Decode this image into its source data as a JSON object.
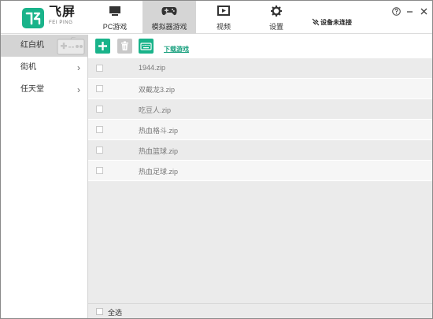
{
  "app": {
    "name_cn": "飞屏",
    "name_en": "FEI PING",
    "accent_color": "#19b38a"
  },
  "tabs": [
    {
      "label": "PC游戏",
      "icon": "monitor-icon",
      "active": false
    },
    {
      "label": "模拟器游戏",
      "icon": "gamepad-icon",
      "active": true
    },
    {
      "label": "视频",
      "icon": "video-icon",
      "active": false
    },
    {
      "label": "设置",
      "icon": "gear-icon",
      "active": false
    }
  ],
  "device_status": "设备未连接",
  "window_controls": [
    "help-icon",
    "minimize-icon",
    "close-icon"
  ],
  "sidebar": {
    "items": [
      {
        "label": "红白机",
        "active": true,
        "has_chevron": false
      },
      {
        "label": "街机",
        "active": false,
        "has_chevron": true
      },
      {
        "label": "任天堂",
        "active": false,
        "has_chevron": true
      }
    ]
  },
  "toolbar": {
    "add_icon": "plus-icon",
    "delete_icon": "trash-icon",
    "keyboard_icon": "keyboard-icon",
    "download_label": "下载游戏"
  },
  "files": [
    {
      "name": "1944.zip",
      "checked": false
    },
    {
      "name": "双截龙3.zip",
      "checked": false
    },
    {
      "name": "吃豆人.zip",
      "checked": false
    },
    {
      "name": "热血格斗.zip",
      "checked": false
    },
    {
      "name": "热血篮球.zip",
      "checked": false
    },
    {
      "name": "热血足球.zip",
      "checked": false
    }
  ],
  "footer": {
    "select_all_label": "全选"
  }
}
